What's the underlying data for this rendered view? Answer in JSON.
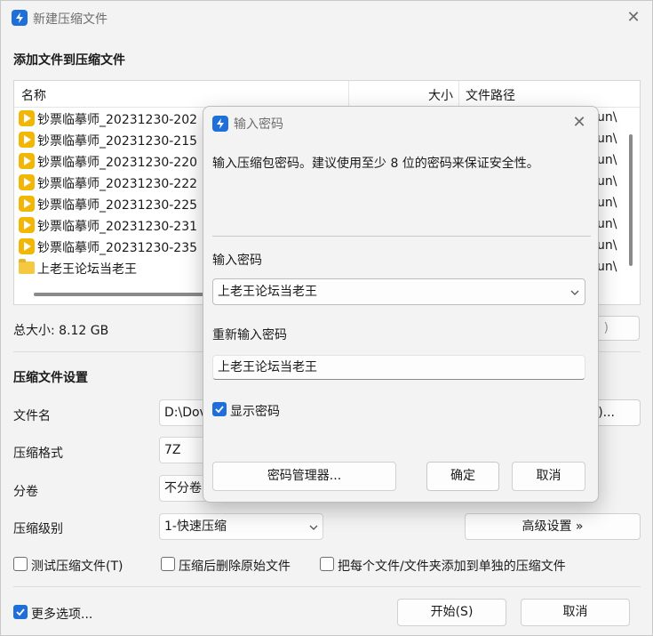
{
  "window": {
    "title": "新建压缩文件",
    "close_icon": "close-icon"
  },
  "files_section": {
    "heading": "添加文件到压缩文件",
    "columns": {
      "name": "名称",
      "size": "大小",
      "path": "文件路径"
    },
    "rows": [
      {
        "name": "钞票临摹师_20231230-202",
        "path": "un\\",
        "icon": "video-file-icon"
      },
      {
        "name": "钞票临摹师_20231230-215",
        "path": "un\\",
        "icon": "video-file-icon"
      },
      {
        "name": "钞票临摹师_20231230-220",
        "path": "un\\",
        "icon": "video-file-icon"
      },
      {
        "name": "钞票临摹师_20231230-222",
        "path": "un\\",
        "icon": "video-file-icon"
      },
      {
        "name": "钞票临摹师_20231230-225",
        "path": "un\\",
        "icon": "video-file-icon"
      },
      {
        "name": "钞票临摹师_20231230-231",
        "path": "un\\",
        "icon": "video-file-icon"
      },
      {
        "name": "钞票临摹师_20231230-235",
        "path": "un\\",
        "icon": "video-file-icon"
      },
      {
        "name": "上老王论坛当老王",
        "path": "un\\",
        "icon": "folder-icon"
      }
    ],
    "total_size": "总大小: 8.12 GB",
    "partial_button": ")"
  },
  "settings": {
    "heading": "压缩文件设置",
    "filename_label": "文件名",
    "filename_value": "D:\\Dov",
    "browse_partial": ")...",
    "format_label": "压缩格式",
    "format_value": "7Z",
    "split_label": "分卷",
    "split_value": "不分卷",
    "level_label": "压缩级别",
    "level_value": "1-快速压缩",
    "advanced_button": "高级设置 »",
    "checkbox_test": "测试压缩文件(T)",
    "checkbox_delete": "压缩后删除原始文件",
    "checkbox_each": "把每个文件/文件夹添加到单独的压缩文件"
  },
  "footer": {
    "more_options": "更多选项...",
    "start_button": "开始(S)",
    "cancel_button": "取消"
  },
  "password_dialog": {
    "title": "输入密码",
    "description": "输入压缩包密码。建议使用至少 8 位的密码来保证安全性。",
    "password_label": "输入密码",
    "password_value": "上老王论坛当老王",
    "repeat_label": "重新输入密码",
    "repeat_value": "上老王论坛当老王",
    "show_password": "显示密码",
    "manager_button": "密码管理器...",
    "ok_button": "确定",
    "cancel_button": "取消"
  },
  "colors": {
    "accent": "#1e6fd9",
    "window_bg": "#f3f3f3",
    "video_icon": "#f2b705"
  }
}
